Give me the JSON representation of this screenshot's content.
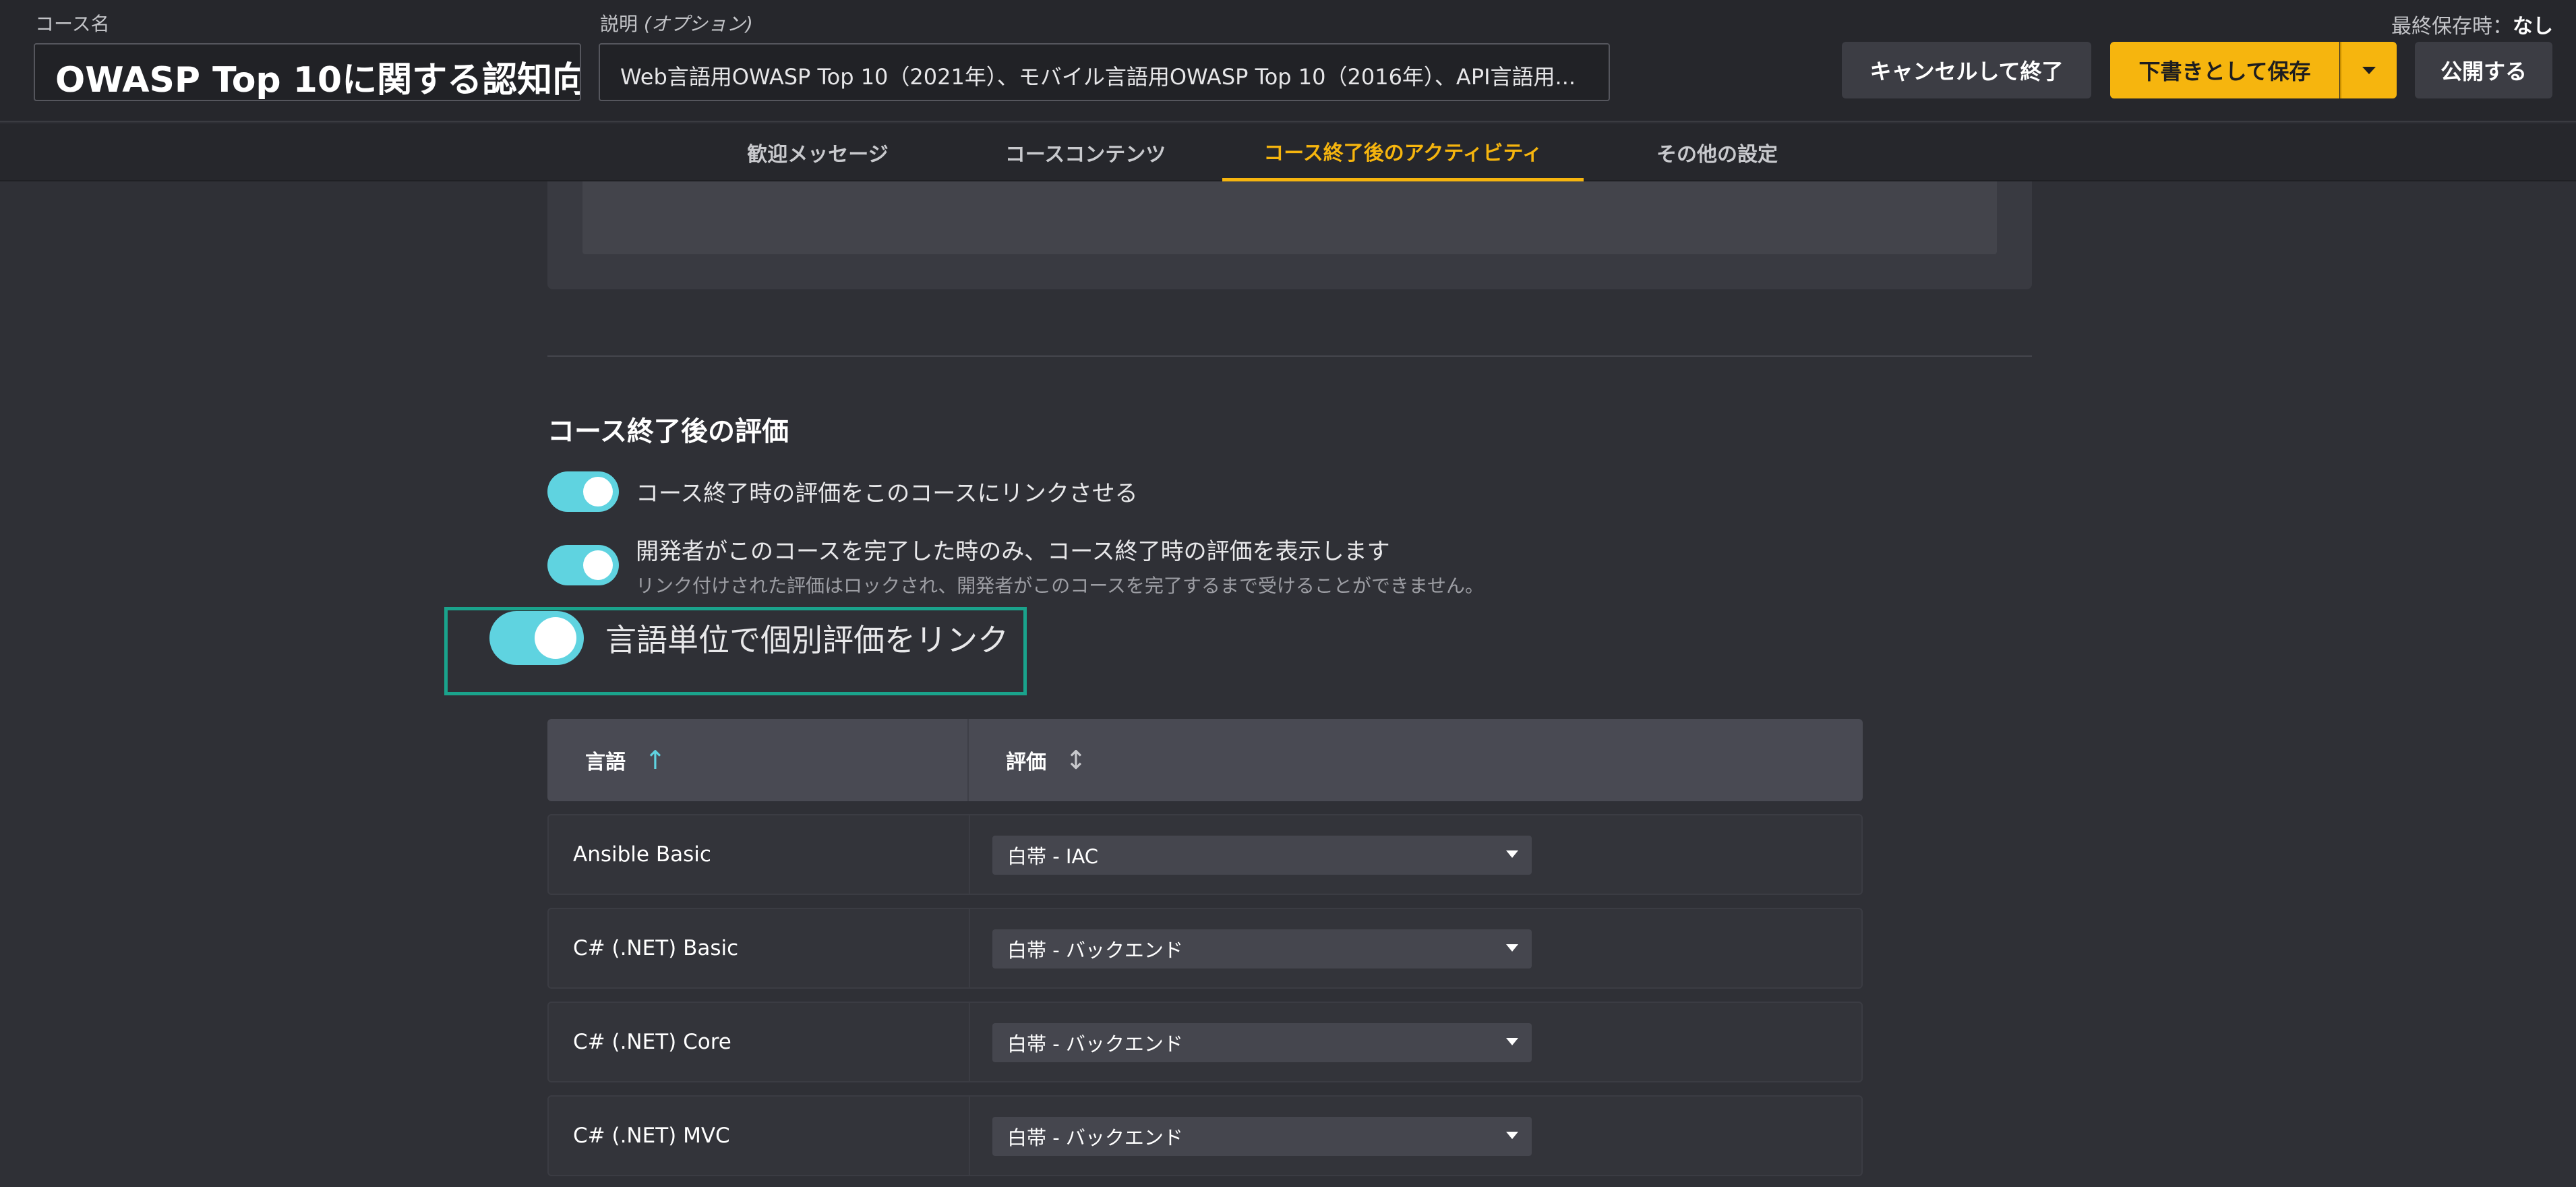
{
  "header": {
    "course_name_label": "コース名",
    "course_name_value": "OWASP Top 10に関する認知向...",
    "description_label": "説明",
    "description_optional": "(オプション)",
    "description_value": "Web言語用OWASP Top 10（2021年）、モバイル言語用OWASP Top 10（2016年）、API言語用...",
    "last_saved_label": "最終保存時：",
    "last_saved_value": "なし",
    "cancel_label": "キャンセルして終了",
    "save_draft_label": "下書きとして保存",
    "publish_label": "公開する"
  },
  "tabs": [
    {
      "label": "歓迎メッセージ",
      "active": false
    },
    {
      "label": "コースコンテンツ",
      "active": false
    },
    {
      "label": "コース終了後のアクティビティ",
      "active": true
    },
    {
      "label": "その他の設定",
      "active": false
    }
  ],
  "assessment": {
    "section_title": "コース終了後の評価",
    "options": [
      {
        "label": "コース終了時の評価をこのコースにリンクさせる",
        "enabled": true
      },
      {
        "label": "開発者がこのコースを完了した時のみ、コース終了時の評価を表示します",
        "sublabel": "リンク付けされた評価はロックされ、開発者がこのコースを完了するまで受けることができません。",
        "enabled": true
      },
      {
        "label": "言語単位で個別評価をリンク",
        "enabled": true
      }
    ]
  },
  "table": {
    "col_language": "言語",
    "col_language_sort": "↑",
    "col_assessment": "評価",
    "col_assessment_sort": "↕",
    "rows": [
      {
        "language": "Ansible Basic",
        "assessment": "白帯 - IAC"
      },
      {
        "language": "C# (.NET) Basic",
        "assessment": "白帯 - バックエンド"
      },
      {
        "language": "C# (.NET) Core",
        "assessment": "白帯 - バックエンド"
      },
      {
        "language": "C# (.NET) MVC",
        "assessment": "白帯 - バックエンド"
      }
    ]
  },
  "colors": {
    "accent": "#f6b50e",
    "toggle_on": "#5fd3e0",
    "highlight": "#1aa38c",
    "background": "#2f3036"
  }
}
